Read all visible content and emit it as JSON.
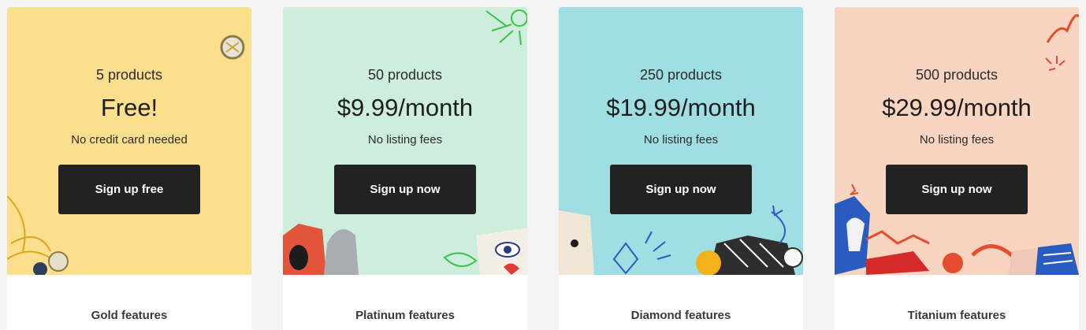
{
  "plans": [
    {
      "count": "5 products",
      "price": "Free!",
      "note": "No credit card needed",
      "cta": "Sign up free",
      "features": "Gold features",
      "bg": "#fbdf8c"
    },
    {
      "count": "50 products",
      "price": "$9.99/month",
      "note": "No listing fees",
      "cta": "Sign up now",
      "features": "Platinum features",
      "bg": "#cdeedd"
    },
    {
      "count": "250 products",
      "price": "$19.99/month",
      "note": "No listing fees",
      "cta": "Sign up now",
      "features": "Diamond features",
      "bg": "#9fdfe3"
    },
    {
      "count": "500 products",
      "price": "$29.99/month",
      "note": "No listing fees",
      "cta": "Sign up now",
      "features": "Titanium features",
      "bg": "#f9d4c0"
    }
  ]
}
